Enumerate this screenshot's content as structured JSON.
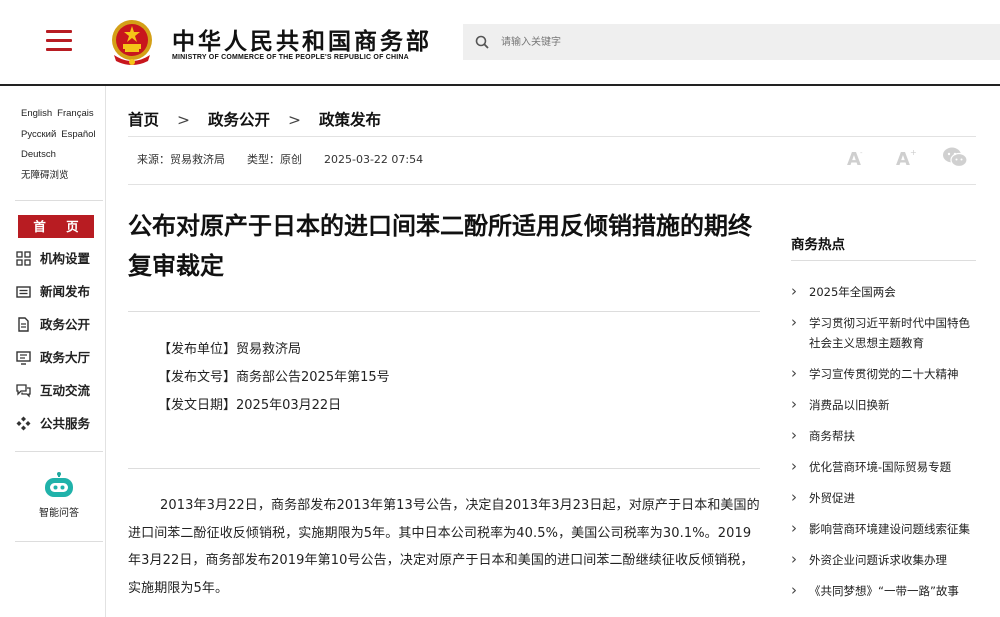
{
  "header": {
    "title": "中华人民共和国商务部",
    "subtitle": "MINISTRY OF COMMERCE OF THE PEOPLE'S REPUBLIC OF CHINA",
    "search_placeholder": "请输入关键字",
    "emblem_icon": "national-emblem-icon",
    "menu_icon": "hamburger-menu-icon",
    "accent_color": "#b81c22"
  },
  "languages": [
    "English",
    "Français",
    "Русский",
    "Español",
    "Deutsch",
    "无障碍浏览"
  ],
  "sidebar": {
    "home": "首 页",
    "items": [
      {
        "label": "机构设置",
        "icon": "org-grid-icon"
      },
      {
        "label": "新闻发布",
        "icon": "news-icon"
      },
      {
        "label": "政务公开",
        "icon": "document-icon"
      },
      {
        "label": "政务大厅",
        "icon": "monitor-icon"
      },
      {
        "label": "互动交流",
        "icon": "chat-icon"
      },
      {
        "label": "公共服务",
        "icon": "service-icon"
      }
    ],
    "assistant": "智能问答"
  },
  "breadcrumb": [
    "首页",
    "政务公开",
    "政策发布"
  ],
  "meta": {
    "source": "来源：贸易救济局",
    "type": "类型：原创",
    "date": "2025-03-22 07:54"
  },
  "article": {
    "title": "公布对原产于日本的进口间苯二酚所适用反倾销措施的期终复审裁定",
    "issuer": "【发布单位】贸易救济局",
    "doc_no": "【发布文号】商务部公告2025年第15号",
    "issue_date": "【发文日期】2025年03月22日",
    "paragraph": "2013年3月22日，商务部发布2013年第13号公告，决定自2013年3月23日起，对原产于日本和美国的进口间苯二酚征收反倾销税，实施期限为5年。其中日本公司税率为40.5%，美国公司税率为30.1%。2019年3月22日，商务部发布2019年第10号公告，决定对原产于日本和美国的进口间苯二酚继续征收反倾销税，实施期限为5年。"
  },
  "hot": {
    "title": "商务热点",
    "items": [
      "2025年全国两会",
      "学习贯彻习近平新时代中国特色社会主义思想主题教育",
      "学习宣传贯彻党的二十大精神",
      "消费品以旧换新",
      "商务帮扶",
      "优化营商环境-国际贸易专题",
      "外贸促进",
      "影响营商环境建设问题线索征集",
      "外资企业问题诉求收集办理",
      "《共同梦想》“一带一路”故事"
    ]
  }
}
